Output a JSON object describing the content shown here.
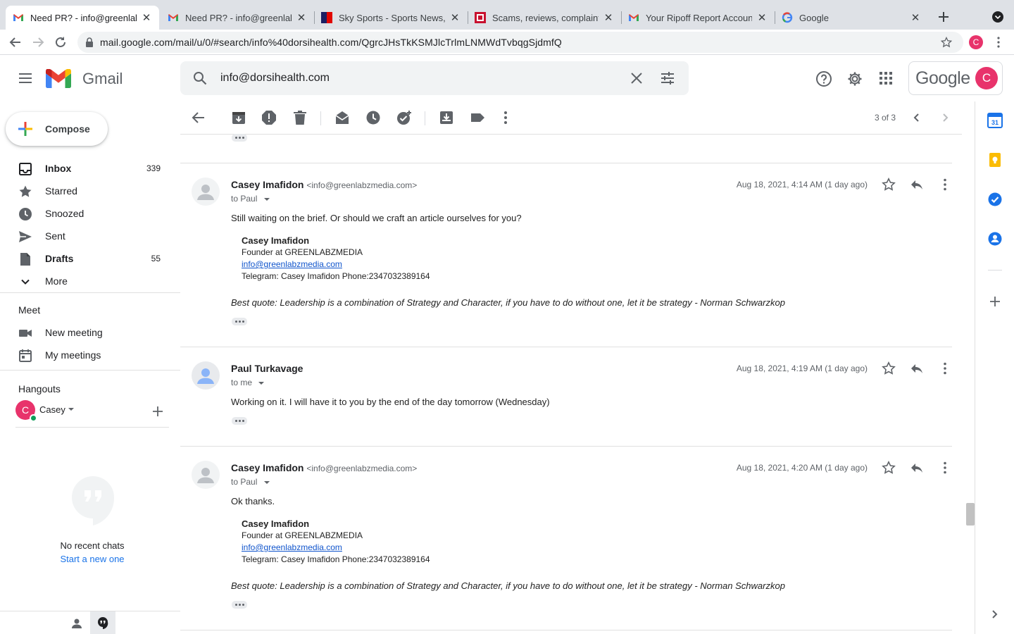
{
  "browser": {
    "tabs": [
      {
        "title": "Need PR? - info@greenlabz",
        "active": true,
        "icon": "gmail-icon"
      },
      {
        "title": "Need PR? - info@greenlabz",
        "active": false,
        "icon": "gmail-icon"
      },
      {
        "title": "Sky Sports - Sports News,",
        "active": false,
        "icon": "sky-sports-icon"
      },
      {
        "title": "Scams, reviews, complaints",
        "active": false,
        "icon": "ripoff-report-icon"
      },
      {
        "title": "Your Ripoff Report Account",
        "active": false,
        "icon": "gmail-icon"
      },
      {
        "title": "Google",
        "active": false,
        "icon": "google-icon"
      }
    ],
    "url": "mail.google.com/mail/u/0/#search/info%40dorsihealth.com/QgrcJHsTkKSMJlcTrlmLNMWdTvbqgSjdmfQ",
    "profile_initial": "C"
  },
  "gmail": {
    "logo_text": "Gmail",
    "search_value": "info@dorsihealth.com",
    "google_text": "Google",
    "account_initial": "C",
    "compose_label": "Compose",
    "nav": [
      {
        "label": "Inbox",
        "count": "339",
        "bold": true,
        "icon": "inbox-icon"
      },
      {
        "label": "Starred",
        "count": "",
        "bold": false,
        "icon": "star-icon"
      },
      {
        "label": "Snoozed",
        "count": "",
        "bold": false,
        "icon": "clock-icon"
      },
      {
        "label": "Sent",
        "count": "",
        "bold": false,
        "icon": "send-icon"
      },
      {
        "label": "Drafts",
        "count": "55",
        "bold": true,
        "icon": "draft-icon"
      },
      {
        "label": "More",
        "count": "",
        "bold": false,
        "icon": "chevron-down-icon"
      }
    ],
    "meet": {
      "heading": "Meet",
      "new_meeting": "New meeting",
      "my_meetings": "My meetings"
    },
    "hangouts": {
      "heading": "Hangouts",
      "user": "Casey",
      "user_initial": "C",
      "no_chats": "No recent chats",
      "start_new": "Start a new one"
    },
    "pagination": "3 of 3"
  },
  "thread": {
    "messages": [
      {
        "sender": "Casey Imafidon",
        "email": "<info@greenlabzmedia.com>",
        "to": "to Paul",
        "date": "Aug 18, 2021, 4:14 AM (1 day ago)",
        "body": "Still waiting on the brief. Or should we craft an article ourselves for you?",
        "signature": {
          "name": "Casey Imafidon",
          "title": "Founder at GREENLABZMEDIA",
          "link": "info@greenlabzmedia.com",
          "contact": "Telegram: Casey Imafidon Phone:2347032389164"
        },
        "quote": "Best quote: Leadership is a combination of Strategy and Character, if you have to do without one, let it be strategy - Norman Schwarzkop"
      },
      {
        "sender": "Paul Turkavage",
        "email": "",
        "to": "to me",
        "date": "Aug 18, 2021, 4:19 AM (1 day ago)",
        "body": "Working on it. I will have it to you by the end of the day tomorrow (Wednesday)"
      },
      {
        "sender": "Casey Imafidon",
        "email": "<info@greenlabzmedia.com>",
        "to": "to Paul",
        "date": "Aug 18, 2021, 4:20 AM (1 day ago)",
        "body": "Ok thanks.",
        "signature": {
          "name": "Casey Imafidon",
          "title": "Founder at GREENLABZMEDIA",
          "link": "info@greenlabzmedia.com",
          "contact": "Telegram: Casey Imafidon Phone:2347032389164"
        },
        "quote": "Best quote: Leadership is a combination of Strategy and Character, if you have to do without one, let it be strategy - Norman Schwarzkop"
      }
    ]
  },
  "colors": {
    "accent_red": "#d93025",
    "link_blue": "#1155cc",
    "profile_pink": "#e8336b",
    "calendar_blue": "#1a73e8",
    "keep_yellow": "#fbbc04"
  }
}
